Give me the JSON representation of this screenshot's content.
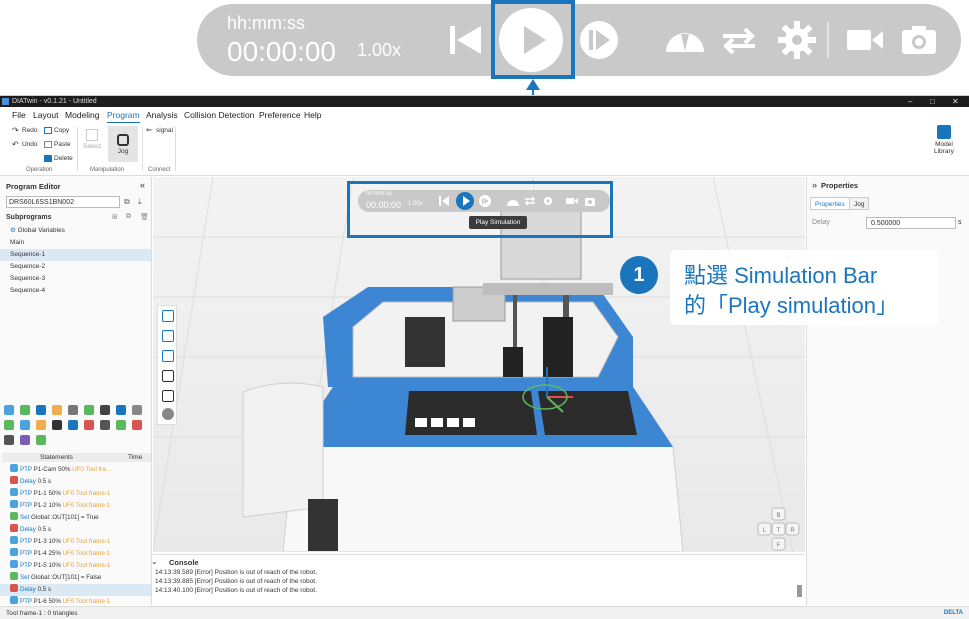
{
  "zoom_bar": {
    "time_label": "hh:mm:ss",
    "time_value": "00:00:00",
    "speed": "1.00x"
  },
  "app": {
    "title": "DIATwin - v0.1.21 - Untitled",
    "menu": [
      "File",
      "Layout",
      "Modeling",
      "Program",
      "Analysis",
      "Collision Detection",
      "Preference",
      "Help"
    ],
    "active_menu": "Program",
    "ribbon": {
      "redo": "Redo",
      "undo": "Undo",
      "copy": "Copy",
      "paste": "Paste",
      "delete": "Delete",
      "select": "Select",
      "jog": "Jog",
      "signal": "signal",
      "group_operation": "Operation",
      "group_manipulation": "Manipulation",
      "group_connect": "Connect",
      "model_library": "Model\nLibrary"
    }
  },
  "program_editor": {
    "title": "Program Editor",
    "robot": "DRS60L6SS1BN002",
    "subprograms_title": "Subprograms",
    "subprograms": [
      "Global Variables",
      "Main",
      "Sequence-1",
      "Sequence-2",
      "Sequence-3",
      "Sequence-4"
    ],
    "selected_subprogram": "Sequence-1",
    "statements_header": "Statements",
    "time_header": "Time",
    "statements": [
      {
        "kw": "PTP",
        "text": "P1-Cam 50%",
        "uf": "UF0",
        "tf": "Tool fra..."
      },
      {
        "kw": "Delay",
        "text": "0.5 s",
        "uf": "",
        "tf": ""
      },
      {
        "kw": "PTP",
        "text": "P1-1 50%",
        "uf": "UF0",
        "tf": "Tool frame-1"
      },
      {
        "kw": "PTP",
        "text": "P1-2 10%",
        "uf": "UF0",
        "tf": "Tool frame-1"
      },
      {
        "kw": "Set",
        "text": "Global::OUT[101] = True",
        "uf": "",
        "tf": ""
      },
      {
        "kw": "Delay",
        "text": "0.5 s",
        "uf": "",
        "tf": ""
      },
      {
        "kw": "PTP",
        "text": "P1-3 10%",
        "uf": "UF0",
        "tf": "Tool frame-1"
      },
      {
        "kw": "PTP",
        "text": "P1-4 25%",
        "uf": "UF0",
        "tf": "Tool frame-1"
      },
      {
        "kw": "PTP",
        "text": "P1-5 10%",
        "uf": "UF0",
        "tf": "Tool frame-1"
      },
      {
        "kw": "Set",
        "text": "Global::OUT[101] = False",
        "uf": "",
        "tf": ""
      },
      {
        "kw": "Delay",
        "text": "0.5 s",
        "uf": "",
        "tf": ""
      },
      {
        "kw": "PTP",
        "text": "P1-6 50%",
        "uf": "UF0",
        "tf": "Tool frame-1"
      }
    ],
    "selected_statement": 10
  },
  "sim_bar": {
    "time_label": "hh:mm:ss",
    "time_value": "00:00:00",
    "speed": "1.00x",
    "tooltip": "Play Simulation"
  },
  "callout": {
    "step": "1",
    "line1": "點選 Simulation Bar",
    "line2": "的「Play simulation」"
  },
  "properties": {
    "title": "Properties",
    "tabs": [
      "Properties",
      "Jog"
    ],
    "delay_label": "Delay",
    "delay_value": "0.500000",
    "delay_unit": "s"
  },
  "console": {
    "title": "Console",
    "lines": [
      "14:13:39.589 [Error] Position is out of reach of the robot.",
      "14:13:39.885 [Error] Position is out of reach of the robot.",
      "14:13:40.100 [Error] Position is out of reach of the robot."
    ]
  },
  "status": {
    "text": "Tool frame-1 : 0 triangles",
    "brand": "DELTA"
  },
  "compass": {
    "top": "B",
    "left": "L",
    "center": "T",
    "right": "R",
    "bottom": "F"
  },
  "colors": {
    "accent": "#1b75bc",
    "bar_gray": "#c9c9c9"
  }
}
